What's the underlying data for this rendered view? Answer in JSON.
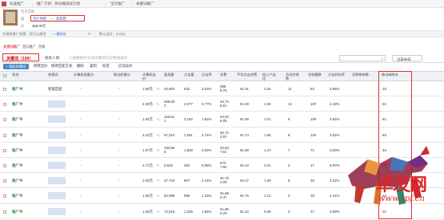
{
  "topnav": {
    "items": [
      "标准推广",
      "推广计划：移动端测试计划",
      "宝贝推广",
      "关键词推广"
    ]
  },
  "product": {
    "title_label": "宝贝名称",
    "category_label": "类",
    "categories": [
      "流行男鞋",
      "低帮鞋"
    ],
    "price_label": "价",
    "price_value": "368.00元"
  },
  "tipbar": {
    "text1": "为提高推广效果，您可以使用",
    "text2": "一键优化",
    "text3": "默认出价：2.25元"
  },
  "tabs1": {
    "items": [
      "关键词推广",
      "定向推广",
      "创意"
    ]
  },
  "tabs2": {
    "active": "关键词（109）",
    "items": [
      "搜索人群",
      "人群数据仅对该关键词对应数据展示"
    ]
  },
  "toolbar": {
    "add_button": "+ 添加关键词",
    "items": [
      "修改出价",
      "修改匹配方式",
      "删除",
      "复制",
      "标签",
      "启动竞价"
    ]
  },
  "search": {
    "icon": "search-icon"
  },
  "date_range": {
    "label": "过去90天"
  },
  "table": {
    "headers": [
      "状态",
      "关键词",
      "计算机质量分",
      "移动质量分",
      "计算机出价",
      "移动出价",
      "展现量",
      "点击量",
      "点击率",
      "花费",
      "平均点击花费",
      "投入产出比",
      "总成交笔数",
      "总收藏数",
      "点击转化率",
      "总购物车数",
      "移动端排名"
    ],
    "rows": [
      {
        "status": "推广中",
        "keyword": "智能匹配",
        "q1": "-",
        "q2": "-",
        "bid": "1.60元",
        "impr": "20,903",
        "clicks": "632",
        "ctr": "3.02%",
        "cost": "¥88\n9.75",
        "cpc": "¥1.41",
        "roi": "2.26",
        "orders": "11",
        "favs": "53",
        "cvr": "3.96%",
        "cart": "25",
        "rank": ""
      },
      {
        "status": "推广中",
        "keyword": "",
        "q1": "-",
        "q2": "-",
        "bid": "2.30元",
        "impr": "268,60\n3",
        "clicks": "2,077",
        "ctr": "0.77%",
        "cost": "¥4,74\n8.61",
        "cpc": "¥2.29",
        "roi": "1.59",
        "orders": "14",
        "favs": "197",
        "cvr": "4.43%",
        "cart": "92",
        "rank": ""
      },
      {
        "status": "推广中",
        "keyword": "",
        "q1": "-",
        "q2": "-",
        "bid": "1.94元",
        "impr": "118,61\n1",
        "clicks": "2,162",
        "ctr": "1.82%",
        "cost": "¥4,02\n8.05",
        "cpc": "¥1.86",
        "roi": "1.01",
        "orders": "9",
        "favs": "106",
        "cvr": "2.82%",
        "cart": "61",
        "rank": ""
      },
      {
        "status": "推广中",
        "keyword": "",
        "q1": "-",
        "q2": "-",
        "bid": "2.22元",
        "impr": "57,014",
        "clicks": "1,561",
        "ctr": "2.74%",
        "cost": "¥2,72\n3.57",
        "cpc": "¥1.74",
        "roi": "1.66",
        "orders": "8",
        "favs": "104",
        "cvr": "3.52%",
        "cart": "55",
        "rank": ""
      },
      {
        "status": "推广中",
        "keyword": "",
        "q1": "-",
        "q2": "-",
        "bid": "1.97元",
        "impr": "163,56\n8",
        "clicks": "1,500",
        "ctr": "0.92%",
        "cost": "¥2,84\n7.61",
        "cpc": "¥1.90",
        "roi": "1.47",
        "orders": "7",
        "favs": "71",
        "cvr": "3.00%",
        "cart": "46",
        "rank": ""
      },
      {
        "status": "推广中",
        "keyword": "",
        "q1": "-",
        "q2": "-",
        "bid": "2.71元",
        "impr": "6,932",
        "clicks": "352",
        "ctr": "5.08%",
        "cost": "¥73\n7.84",
        "cpc": "¥2.10",
        "roi": "2.01",
        "orders": "3",
        "favs": "17",
        "cvr": "5.97%",
        "cart": "20",
        "rank": ""
      },
      {
        "status": "推广中",
        "keyword": "",
        "q1": "-",
        "q2": "-",
        "bid": "2.05元",
        "impr": "37,724",
        "clicks": "807",
        "ctr": "2.14%",
        "cost": "¥1,75\n2.00",
        "cpc": "¥2.17",
        "roi": "1.29",
        "orders": "5",
        "favs": "45",
        "cvr": "3.22%",
        "cart": "22",
        "rank": ""
      },
      {
        "status": "推广中",
        "keyword": "",
        "q1": "-",
        "q2": "-",
        "bid": "1.94元",
        "impr": "82,898",
        "clicks": "955",
        "ctr": "1.15%",
        "cost": "¥1,68\n0.47",
        "cpc": "¥1.76",
        "roi": "1.14",
        "orders": "3",
        "favs": "39",
        "cvr": "2.41%",
        "cart": "22",
        "rank": ""
      },
      {
        "status": "推广中",
        "keyword": "",
        "q1": "-",
        "q2": "-",
        "bid": "1.66元",
        "impr": "72,519",
        "clicks": "1,339",
        "ctr": "1.85%",
        "cost": "¥1,90\n6.29",
        "cpc": "¥1.42",
        "roi": "0.65",
        "orders": "3",
        "favs": "37",
        "cvr": "2.99%",
        "cart": "21",
        "rank": ""
      }
    ]
  },
  "watermark": {
    "text": "卓发网",
    "url": "www.spf.cn",
    "color": "#d8262a"
  }
}
